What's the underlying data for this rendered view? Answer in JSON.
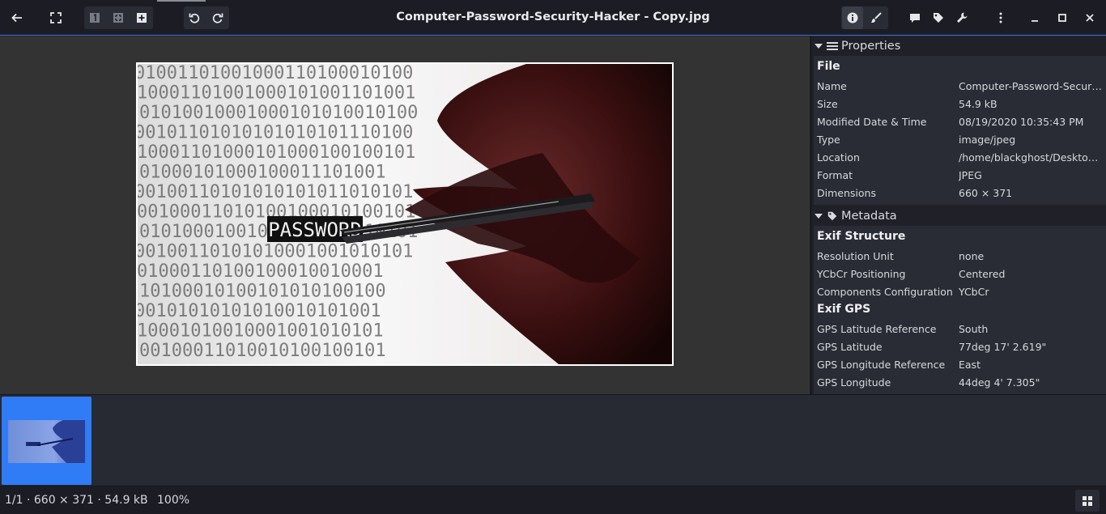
{
  "window": {
    "title": "Computer-Password-Security-Hacker - Copy.jpg"
  },
  "toolbar": {
    "icons": [
      "back-arrow-icon",
      "fullscreen-icon",
      "zoom-original-icon",
      "zoom-fit-icon",
      "zoom-fill-icon",
      "rotate-left-icon",
      "rotate-right-icon",
      "info-icon",
      "brush-icon",
      "comment-icon",
      "tag-icon",
      "wrench-icon",
      "kebab-menu-icon",
      "minimize-icon",
      "maximize-icon",
      "close-icon"
    ],
    "accent_color": "#3a6fd8"
  },
  "image": {
    "word": "PASSWORD",
    "binary_lines": [
      "01001101001000110100010100",
      "10001101001000101001101001",
      "01010010001000101010010100",
      "00101101010101010101110100",
      "10001101000101000100100101",
      "01000101000100011101001",
      "00100110101010101011010101",
      "00100011010100100010100101",
      "01010001001010010101010101",
      "00100110101010001001010101",
      "01000110100100010010001",
      "10100010100101010100100",
      "00101010101010010101001",
      "10001010010001001010101",
      "00100011010010100100101"
    ]
  },
  "sidebar": {
    "properties": {
      "title": "Properties",
      "groups": [
        {
          "title": "File",
          "rows": [
            {
              "key": "Name",
              "value": "Computer-Password-Securi…"
            },
            {
              "key": "Size",
              "value": "54.9 kB"
            },
            {
              "key": "Modified Date & Time",
              "value": "08/19/2020 10:35:43 PM"
            },
            {
              "key": "Type",
              "value": "image/jpeg"
            },
            {
              "key": "Location",
              "value": "/home/blackghost/Desktop/C…"
            },
            {
              "key": "Format",
              "value": "JPEG"
            },
            {
              "key": "Dimensions",
              "value": "660 × 371"
            }
          ]
        }
      ]
    },
    "metadata": {
      "title": "Metadata",
      "groups": [
        {
          "title": "Exif Structure",
          "rows": [
            {
              "key": "Resolution Unit",
              "value": "none"
            },
            {
              "key": "YCbCr Positioning",
              "value": "Centered"
            },
            {
              "key": "Components Configuration",
              "value": "YCbCr"
            }
          ]
        },
        {
          "title": "Exif GPS",
          "rows": [
            {
              "key": "GPS Latitude Reference",
              "value": "South"
            },
            {
              "key": "GPS Latitude",
              "value": "77deg 17' 2.619\""
            },
            {
              "key": "GPS Longitude Reference",
              "value": "East"
            },
            {
              "key": "GPS Longitude",
              "value": "44deg 4' 7.305\""
            }
          ]
        }
      ]
    }
  },
  "status": {
    "info": "1/1  ·  660 × 371  ·  54.9 kB",
    "zoom": "100%"
  }
}
